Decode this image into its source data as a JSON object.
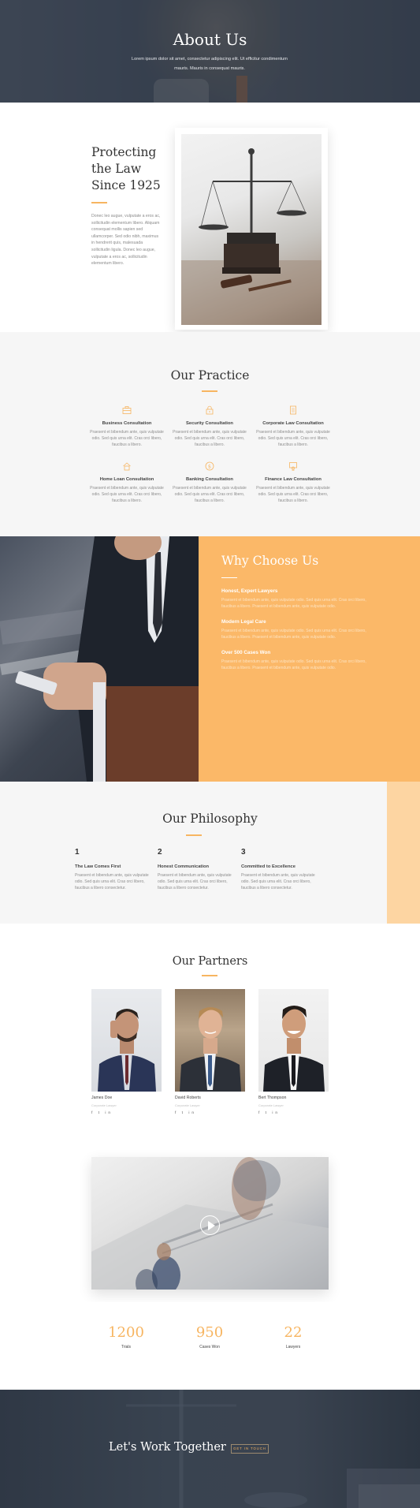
{
  "hero": {
    "title": "About Us",
    "subtitle": "Lorem ipsum dolor sit amet, consectetur adipiscing elit. Ut efficitur condimentum mauris. Mauris in consequat mauris."
  },
  "about": {
    "heading": "Protecting the Law Since 1925",
    "body": "Donec leo augue, vulputate a eros ac, sollicitudin elementum libero. Aliquam consequat mollis sapien sed ullamcorper. Sed odio nibh, maximus in hendrerit quis, malesuada sollicitudin ligula. Donec leo augue, vulputate a eros ac, sollicitudin elementum libero."
  },
  "practice": {
    "heading": "Our Practice",
    "services": [
      {
        "title": "Business Consultation",
        "text": "Praesent et bibendum ante, quis vulputate odio. Sed quis urna elit. Cras orci libero, faucibus a libero.",
        "icon": "briefcase-icon"
      },
      {
        "title": "Security Consultation",
        "text": "Praesent et bibendum ante, quis vulputate odio. Sed quis urna elit. Cras orci libero, faucibus a libero.",
        "icon": "lock-icon"
      },
      {
        "title": "Corporate Law Consultation",
        "text": "Praesent et bibendum ante, quis vulputate odio. Sed quis urna elit. Cras orci libero, faucibus a libero.",
        "icon": "document-icon"
      },
      {
        "title": "Home Loan Consultation",
        "text": "Praesent et bibendum ante, quis vulputate odio. Sed quis urna elit. Cras orci libero, faucibus a libero.",
        "icon": "house-icon"
      },
      {
        "title": "Banking Consultation",
        "text": "Praesent et bibendum ante, quis vulputate odio. Sed quis urna elit. Cras orci libero, faucibus a libero.",
        "icon": "dollar-icon"
      },
      {
        "title": "Finance Law Consultation",
        "text": "Praesent et bibendum ante, quis vulputate odio. Sed quis urna elit. Cras orci libero, faucibus a libero.",
        "icon": "certificate-icon"
      }
    ]
  },
  "why": {
    "heading": "Why Choose Us",
    "items": [
      {
        "title": "Honest, Expert Lawyers",
        "text": "Praesent et bibendum ante, quis vulputate odio. Sed quis urna elit. Cras orci libero, faucibus a libero. Praesent et bibendum ante, quis vulputate odio."
      },
      {
        "title": "Modern Legal Care",
        "text": "Praesent et bibendum ante, quis vulputate odio. Sed quis urna elit. Cras orci libero, faucibus a libero. Praesent et bibendum ante, quis vulputate odio."
      },
      {
        "title": "Over 500 Cases Won",
        "text": "Praesent et bibendum ante, quis vulputate odio. Sed quis urna elit. Cras orci libero, faucibus a libero. Praesent et bibendum ante, quis vulputate odio."
      }
    ]
  },
  "philosophy": {
    "heading": "Our Philosophy",
    "items": [
      {
        "num": "1",
        "title": "The Law Comes First",
        "text": "Praesent et bibendum ante, quis vulputate odio. Sed quis urna elit. Cras orci libero, faucibus a libero consectetur."
      },
      {
        "num": "2",
        "title": "Honest Communication",
        "text": "Praesent et bibendum ante, quis vulputate odio. Sed quis urna elit. Cras orci libero, faucibus a libero consectetur."
      },
      {
        "num": "3",
        "title": "Committed to Excellence",
        "text": "Praesent et bibendum ante, quis vulputate odio. Sed quis urna elit. Cras orci libero, faucibus a libero consectetur."
      }
    ]
  },
  "partners": {
    "heading": "Our Partners",
    "people": [
      {
        "name": "James Doe",
        "role": "Corporate Lawyer",
        "social": "f  t  in"
      },
      {
        "name": "David Roberts",
        "role": "Corporate Lawyer",
        "social": "f  t  in"
      },
      {
        "name": "Bert Thompson",
        "role": "Corporate Lawyer",
        "social": "f  t  in"
      }
    ]
  },
  "stats": [
    {
      "number": "1200",
      "label": "Trials"
    },
    {
      "number": "950",
      "label": "Cases Won"
    },
    {
      "number": "22",
      "label": "Lawyers"
    }
  ],
  "cta": {
    "heading": "Let's Work Together",
    "button": "GET IN TOUCH"
  },
  "colors": {
    "accent": "#f7b561",
    "accent_block": "#fbb868",
    "dark": "#36404c"
  }
}
